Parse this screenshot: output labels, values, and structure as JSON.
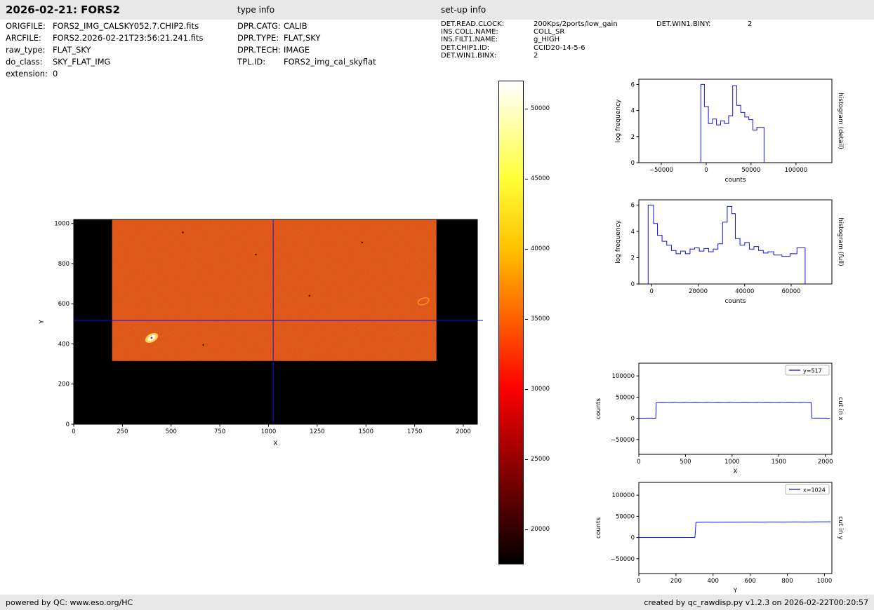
{
  "header": {
    "title": "2026-02-21: FORS2",
    "sections": {
      "type_info": "type info",
      "setup_info": "set-up info"
    }
  },
  "file_info": [
    {
      "label": "ORIGFILE:",
      "value": "FORS2_IMG_CALSKY052.7.CHIP2.fits"
    },
    {
      "label": "ARCFILE:",
      "value": "FORS2.2026-02-21T23:56:21.241.fits"
    },
    {
      "label": "raw_type:",
      "value": "FLAT_SKY"
    },
    {
      "label": "do_class:",
      "value": "SKY_FLAT_IMG"
    },
    {
      "label": "extension:",
      "value": "0"
    }
  ],
  "type_info": [
    {
      "label": "DPR.CATG:",
      "value": "CALIB"
    },
    {
      "label": "DPR.TYPE:",
      "value": "FLAT,SKY"
    },
    {
      "label": "DPR.TECH:",
      "value": "IMAGE"
    },
    {
      "label": "TPL.ID:",
      "value": "FORS2_img_cal_skyflat"
    }
  ],
  "setup_info": [
    {
      "label": "DET.READ.CLOCK:",
      "value": "200Kps/2ports/low_gain"
    },
    {
      "label": "INS.COLL.NAME:",
      "value": "COLL_SR"
    },
    {
      "label": "INS.FILT1.NAME:",
      "value": "g_HIGH"
    },
    {
      "label": "DET.CHIP1.ID:",
      "value": "CCID20-14-5-6"
    },
    {
      "label": "DET.WIN1.BINX:",
      "value": "2"
    }
  ],
  "setup_info_col2": [
    {
      "label": "DET.WIN1.BINY:",
      "value": "2"
    }
  ],
  "footer": {
    "left": "powered by QC: www.eso.org/HC",
    "right": "created by qc_rawdisp.py v1.2.3 on 2026-02-22T00:20:57"
  },
  "colors": {
    "plot_line": "#1414dd",
    "flat_field": "#f2601c",
    "detector_background": "#000000",
    "bar_background": "#e8e8e8",
    "star_halo": "#ffd24a",
    "star_core": "#ffffff",
    "ghost_ring": "#ff9c2a"
  },
  "chart_data": [
    {
      "id": "image-plot",
      "type": "heatmap",
      "description": "raw sky-flat image display",
      "xlabel": "X",
      "ylabel": "Y",
      "xlim": [
        0,
        2072
      ],
      "ylim": [
        0,
        1020
      ],
      "xticks": [
        0,
        250,
        500,
        750,
        1000,
        1250,
        1500,
        1750,
        2000
      ],
      "yticks": [
        0,
        200,
        400,
        600,
        800,
        1000
      ],
      "background_counts": 0,
      "illuminated_region": {
        "x0": 197,
        "x1": 1862,
        "y0": 315,
        "y1": 1020,
        "mean_counts": 37000
      },
      "crosshair_x": 1024,
      "crosshair_y": 517,
      "features": [
        {
          "kind": "saturated-star",
          "x": 400,
          "y": 430
        },
        {
          "kind": "ghost-ring",
          "x": 1795,
          "y": 612
        },
        {
          "kind": "dark-speck",
          "x": 560,
          "y": 955
        },
        {
          "kind": "dark-speck",
          "x": 935,
          "y": 845
        },
        {
          "kind": "dark-speck",
          "x": 1210,
          "y": 640
        },
        {
          "kind": "dark-speck",
          "x": 665,
          "y": 395
        },
        {
          "kind": "dark-speck",
          "x": 1480,
          "y": 905
        }
      ]
    },
    {
      "id": "colorbar",
      "type": "colorbar",
      "range": [
        17500,
        52000
      ],
      "ticks": [
        20000,
        25000,
        30000,
        35000,
        40000,
        45000,
        50000
      ],
      "colormap": "hot",
      "stops": [
        {
          "value": 17500,
          "color": "#000000"
        },
        {
          "value": 20000,
          "color": "#330000"
        },
        {
          "value": 25000,
          "color": "#970000"
        },
        {
          "value": 30000,
          "color": "#fb0000"
        },
        {
          "value": 35000,
          "color": "#ff6000"
        },
        {
          "value": 40000,
          "color": "#ffc100"
        },
        {
          "value": 45000,
          "color": "#ffff36"
        },
        {
          "value": 50000,
          "color": "#ffffc8"
        },
        {
          "value": 52000,
          "color": "#ffffff"
        }
      ]
    },
    {
      "id": "hist-detail",
      "type": "line",
      "right_label": "histogram (detail)",
      "xlabel": "counts",
      "ylabel": "log frequency",
      "xlim": [
        -75000,
        140000
      ],
      "ylim": [
        0,
        6.4
      ],
      "xticks": [
        -50000,
        0,
        50000,
        100000
      ],
      "yticks": [
        0,
        2,
        4,
        6
      ],
      "series": [
        {
          "name": "histogram detail",
          "x": [
            -6000,
            -6000,
            -2000,
            -2000,
            2500,
            2500,
            7000,
            7000,
            11500,
            11500,
            16000,
            16000,
            20500,
            20500,
            25000,
            25000,
            29500,
            29500,
            34000,
            34000,
            38500,
            38500,
            43000,
            43000,
            47500,
            47500,
            52000,
            52000,
            56500,
            56500,
            64500,
            64500
          ],
          "y": [
            0,
            6,
            6,
            4.3,
            4.3,
            3.0,
            3.0,
            3.35,
            3.35,
            2.9,
            2.9,
            3.2,
            3.2,
            3.0,
            3.0,
            3.6,
            3.6,
            5.9,
            5.9,
            4.4,
            4.4,
            3.85,
            3.85,
            3.5,
            3.5,
            3.3,
            3.3,
            2.5,
            2.5,
            2.7,
            2.7,
            0
          ]
        }
      ]
    },
    {
      "id": "hist-full",
      "type": "line",
      "right_label": "histogram (full)",
      "xlabel": "counts",
      "ylabel": "log frequency",
      "xlim": [
        -5500,
        77500
      ],
      "ylim": [
        0,
        6.4
      ],
      "xticks": [
        0,
        20000,
        40000,
        60000
      ],
      "yticks": [
        0,
        2,
        4,
        6
      ],
      "series": [
        {
          "name": "histogram full",
          "x": [
            -1500,
            -1500,
            800,
            800,
            2500,
            2500,
            4500,
            4500,
            6500,
            6500,
            8500,
            8500,
            10500,
            10500,
            12500,
            12500,
            14500,
            14500,
            16500,
            16500,
            18500,
            18500,
            20500,
            20500,
            22500,
            22500,
            24500,
            24500,
            26500,
            26500,
            28500,
            28500,
            30500,
            30500,
            32500,
            32500,
            34500,
            34500,
            36000,
            36000,
            38000,
            38000,
            40000,
            40000,
            42000,
            42000,
            44000,
            44000,
            46000,
            46000,
            48000,
            48000,
            50000,
            50000,
            52500,
            52500,
            56000,
            56000,
            59500,
            59500,
            62500,
            62500,
            66000,
            66000
          ],
          "y": [
            0,
            6,
            6,
            4.6,
            4.6,
            3.7,
            3.7,
            3.25,
            3.25,
            2.95,
            2.95,
            2.55,
            2.55,
            2.3,
            2.3,
            2.5,
            2.5,
            2.3,
            2.3,
            2.65,
            2.65,
            2.75,
            2.75,
            2.5,
            2.5,
            2.7,
            2.7,
            2.45,
            2.45,
            2.65,
            2.65,
            3.05,
            3.05,
            4.7,
            4.7,
            5.9,
            5.9,
            5.35,
            5.35,
            3.45,
            3.45,
            2.95,
            2.95,
            3.15,
            3.15,
            2.65,
            2.65,
            2.85,
            2.85,
            2.55,
            2.55,
            2.35,
            2.35,
            2.45,
            2.45,
            2.2,
            2.2,
            2.1,
            2.1,
            2.3,
            2.3,
            2.75,
            2.75,
            0
          ]
        }
      ]
    },
    {
      "id": "cut-x",
      "type": "line",
      "right_label": "cut in x",
      "legend": "y=517",
      "xlabel": "X",
      "ylabel": "counts",
      "xlim": [
        0,
        2070
      ],
      "ylim": [
        -85000,
        130000
      ],
      "xticks": [
        0,
        500,
        1000,
        1500,
        2000
      ],
      "yticks": [
        -50000,
        0,
        50000,
        100000
      ],
      "series": [
        {
          "name": "y=517",
          "x": [
            0,
            90,
            182,
            186,
            240,
            300,
            360,
            420,
            480,
            540,
            600,
            660,
            720,
            780,
            840,
            900,
            960,
            1020,
            1080,
            1140,
            1200,
            1260,
            1320,
            1380,
            1440,
            1500,
            1560,
            1620,
            1680,
            1740,
            1800,
            1848,
            1854,
            1900,
            1980,
            2048
          ],
          "y": [
            200,
            300,
            250,
            36800,
            37300,
            36900,
            37400,
            37000,
            37350,
            36850,
            37300,
            37050,
            37400,
            36900,
            37250,
            37000,
            37450,
            37100,
            36850,
            37300,
            37000,
            37400,
            36950,
            37250,
            37050,
            37400,
            36900,
            37200,
            37000,
            37350,
            37100,
            37200,
            500,
            300,
            350,
            250
          ]
        }
      ]
    },
    {
      "id": "cut-y",
      "type": "line",
      "right_label": "cut in y",
      "legend": "x=1024",
      "xlabel": "Y",
      "ylabel": "counts",
      "xlim": [
        0,
        1040
      ],
      "ylim": [
        -85000,
        130000
      ],
      "xticks": [
        0,
        200,
        400,
        600,
        800,
        1000
      ],
      "yticks": [
        -50000,
        0,
        50000,
        100000
      ],
      "series": [
        {
          "name": "x=1024",
          "x": [
            0,
            80,
            160,
            240,
            302,
            308,
            360,
            420,
            480,
            540,
            600,
            660,
            720,
            780,
            840,
            900,
            960,
            1010,
            1034
          ],
          "y": [
            150,
            200,
            130,
            180,
            160,
            35700,
            36100,
            35900,
            36250,
            36100,
            36400,
            36250,
            36550,
            36400,
            36700,
            36600,
            36950,
            37100,
            37150
          ]
        }
      ]
    }
  ]
}
